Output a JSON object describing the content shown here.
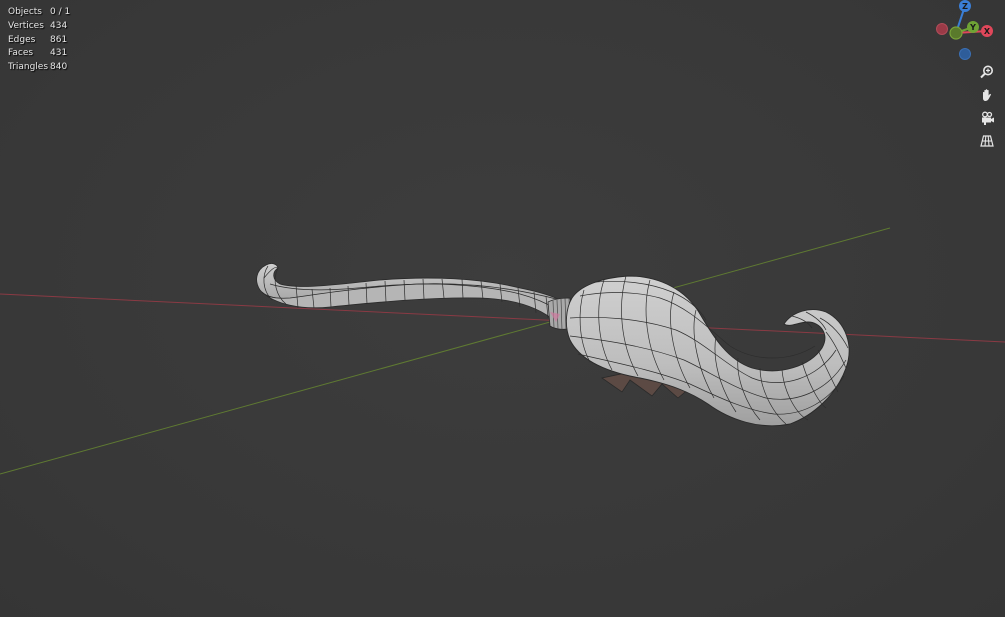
{
  "stats": {
    "objects_label": "Objects",
    "objects_value": "0 / 1",
    "vertices_label": "Vertices",
    "vertices_value": "434",
    "edges_label": "Edges",
    "edges_value": "861",
    "faces_label": "Faces",
    "faces_value": "431",
    "triangles_label": "Triangles",
    "triangles_value": "840"
  },
  "gizmo": {
    "z_label": "Z",
    "y_label": "Y",
    "x_label": "X",
    "colors": {
      "x": "#e0475a",
      "y": "#6fa335",
      "z": "#3a7ed6",
      "neg_x": "#9a3a47",
      "neg_y": "#5a7a2c",
      "neg_z": "#2e5d9a"
    }
  },
  "nav_buttons": [
    {
      "name": "zoom",
      "icon": "zoom-icon"
    },
    {
      "name": "pan",
      "icon": "hand-icon"
    },
    {
      "name": "camera",
      "icon": "camera-icon"
    },
    {
      "name": "perspective",
      "icon": "grid-perspective-icon"
    }
  ],
  "colors": {
    "background": "#393939",
    "x_axis_line": "#8a3a44",
    "y_axis_line": "#5f7a32",
    "mesh_fill": "#b9b9b9",
    "mesh_wire": "#2a2a2a"
  }
}
